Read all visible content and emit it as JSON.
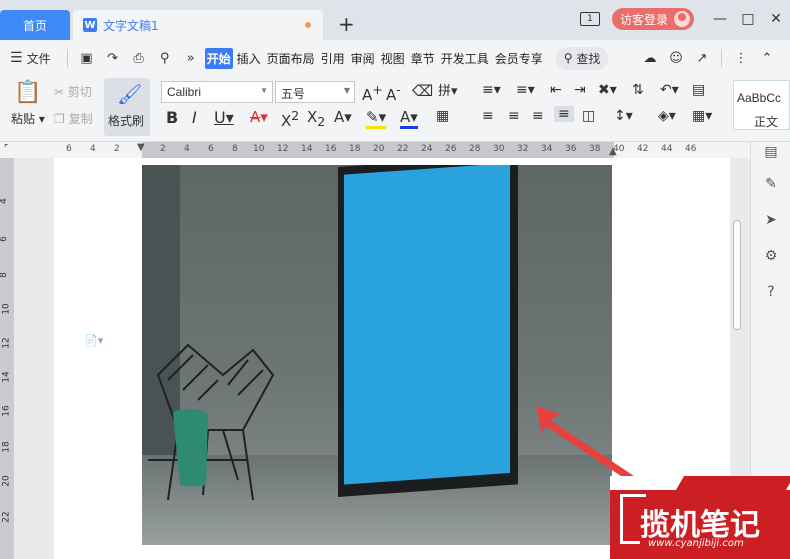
{
  "tabs": {
    "home": "首页",
    "document": "文字文稿1",
    "add": "+"
  },
  "titlebar": {
    "badge": "1",
    "visitor": "访客登录"
  },
  "menu": {
    "file": "文件",
    "tabs": [
      "开始",
      "插入",
      "页面布局",
      "引用",
      "审阅",
      "视图",
      "章节",
      "开发工具",
      "会员专享"
    ],
    "active_tab": "开始",
    "search": "查找"
  },
  "ribbon": {
    "paste": "粘贴",
    "cut": "剪切",
    "copy": "复制",
    "format_painter": "格式刷",
    "font": "Calibri",
    "size": "五号",
    "style_preview": "AaBbCc",
    "style_name": "正文"
  },
  "ruler": {
    "h": [
      "6",
      "4",
      "2",
      "2",
      "4",
      "6",
      "8",
      "10",
      "12",
      "14",
      "16",
      "18",
      "20",
      "22",
      "24",
      "26",
      "28",
      "30",
      "32",
      "34",
      "36",
      "38",
      "40",
      "42",
      "44",
      "46"
    ],
    "v": [
      "4",
      "6",
      "8",
      "10",
      "12",
      "14",
      "16",
      "18",
      "20",
      "22"
    ]
  },
  "watermark": {
    "text": "揽机笔记",
    "url": "www.cyanjibiji.com"
  },
  "colors": {
    "accent": "#3d7bf5",
    "home_tab": "#3d8af7",
    "visitor": "#e96d6b",
    "poster": "#2aa2dd",
    "arrow": "#e8403c",
    "watermark": "#cc1f24"
  }
}
